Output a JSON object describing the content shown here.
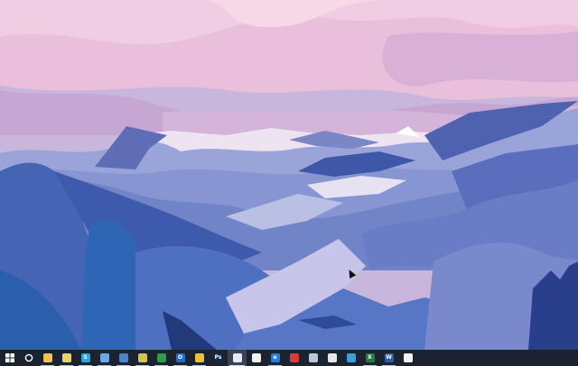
{
  "wallpaper": {
    "sky": "#c9b6dc"
  },
  "taskbar": {
    "background": "#1c2330",
    "start_button": {
      "icon": "windows-logo-icon",
      "color": "#ffffff"
    },
    "search_button": {
      "icon": "cortana-ring-icon",
      "color": "#ffffff"
    },
    "apps": [
      {
        "id": "file-explorer",
        "icon": "folder-icon",
        "color": "#f2c14e",
        "glyph": "",
        "running": true
      },
      {
        "id": "wechat",
        "icon": "wechat-icon",
        "color": "#e9d36a",
        "glyph": "",
        "running": true
      },
      {
        "id": "skype",
        "icon": "skype-icon",
        "color": "#2aa7e0",
        "glyph": "S",
        "running": true
      },
      {
        "id": "settings",
        "icon": "gear-icon",
        "color": "#6aa8e8",
        "glyph": "",
        "running": true
      },
      {
        "id": "steam",
        "icon": "steam-icon",
        "color": "#4a86c7",
        "glyph": "",
        "running": true
      },
      {
        "id": "sketchup",
        "icon": "sketch-icon",
        "color": "#d7c24a",
        "glyph": "",
        "running": true
      },
      {
        "id": "quickbooks",
        "icon": "green-app-icon",
        "color": "#2e9d4a",
        "glyph": "",
        "running": true
      },
      {
        "id": "outlook",
        "icon": "outlook-icon",
        "color": "#1f6fd1",
        "glyph": "O",
        "running": true
      },
      {
        "id": "feedback",
        "icon": "yellow-app-icon",
        "color": "#e8c23a",
        "glyph": "",
        "running": true
      },
      {
        "id": "photoshop",
        "icon": "photoshop-icon",
        "color": "#0e2a47",
        "glyph": "Ps",
        "running": false
      },
      {
        "id": "messages",
        "icon": "chat-icon",
        "color": "#e7ecf4",
        "glyph": "",
        "running": false,
        "active": true
      },
      {
        "id": "wallet",
        "icon": "white-app-icon",
        "color": "#f1f1f1",
        "glyph": "",
        "running": false
      },
      {
        "id": "edge",
        "icon": "edge-icon",
        "color": "#2b7bd8",
        "glyph": "e",
        "running": true
      },
      {
        "id": "netease",
        "icon": "music-icon",
        "color": "#d93b3b",
        "glyph": "",
        "running": false
      },
      {
        "id": "weather",
        "icon": "cloud-icon",
        "color": "#b9c6d8",
        "glyph": "",
        "running": false
      },
      {
        "id": "baidu",
        "icon": "paw-icon",
        "color": "#e8e8e8",
        "glyph": "",
        "running": false
      },
      {
        "id": "telegram",
        "icon": "telegram-icon",
        "color": "#3a9fdc",
        "glyph": "",
        "running": false
      },
      {
        "id": "excel",
        "icon": "excel-icon",
        "color": "#1f7a45",
        "glyph": "X",
        "running": true
      },
      {
        "id": "word",
        "icon": "word-icon",
        "color": "#2b5ea8",
        "glyph": "W",
        "running": true
      },
      {
        "id": "store",
        "icon": "store-bag-icon",
        "color": "#f3f3f3",
        "glyph": "",
        "running": false
      }
    ]
  }
}
